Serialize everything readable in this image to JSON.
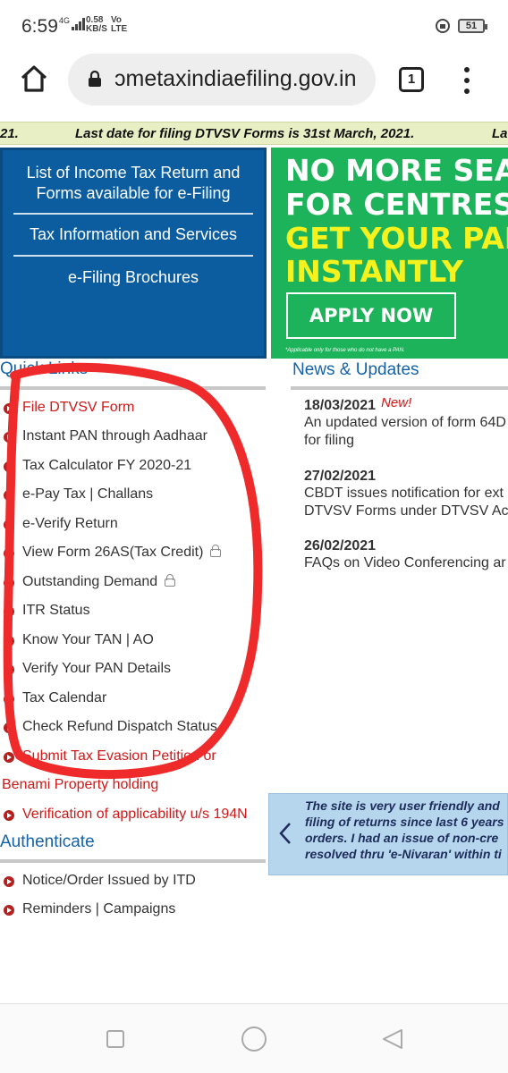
{
  "status_bar": {
    "time": "6:59",
    "network": "4G",
    "speed_value": "0.58",
    "speed_unit": "KB/S",
    "volte_top": "Vo",
    "volte_bottom": "LTE",
    "battery": "51"
  },
  "browser": {
    "url": "ɔmetaxindiaefiling.gov.in",
    "tab_count": "1"
  },
  "ticker": {
    "left_fragment": "21.",
    "message": "Last date for filing DTVSV Forms is 31st March, 2021.",
    "right_fragment": "La"
  },
  "blue_menu": {
    "items": [
      "List of Income Tax Return and Forms available for e-Filing",
      "Tax Information and Services",
      "e-Filing Brochures"
    ]
  },
  "banner": {
    "line1": "NO MORE SEA",
    "line2": "FOR CENTRES.",
    "line3": "GET YOUR PAN",
    "line4": "INSTANTLY",
    "apply": "APPLY NOW",
    "note": "*Applicable only for those who do not have a PAN.",
    "colors": {
      "background": "#1db35a",
      "white": "#ffffff",
      "yellow": "#f5f21e"
    }
  },
  "quick_links": {
    "heading": "Quick Links",
    "items": [
      {
        "label": "File DTVSV Form",
        "style": "red"
      },
      {
        "label": "Instant PAN through Aadhaar",
        "style": "dark"
      },
      {
        "label": "Tax Calculator FY 2020-21",
        "style": "dark"
      },
      {
        "label": "e-Pay Tax | Challans",
        "style": "dark"
      },
      {
        "label": "e-Verify Return",
        "style": "dark"
      },
      {
        "label": "View Form 26AS(Tax Credit)",
        "style": "dark",
        "lock": true
      },
      {
        "label": "Outstanding Demand",
        "style": "dark",
        "lock": true
      },
      {
        "label": "ITR Status",
        "style": "dark"
      },
      {
        "label": "Know Your TAN | AO",
        "style": "dark"
      },
      {
        "label": "Verify Your PAN Details",
        "style": "dark"
      },
      {
        "label": "Tax Calendar",
        "style": "dark"
      },
      {
        "label": "Check Refund Dispatch Status",
        "style": "dark"
      },
      {
        "label": "Submit Tax Evasion Petition or",
        "style": "red"
      },
      {
        "label": "Benami Property holding",
        "style": "red",
        "no_bullet": true
      },
      {
        "label": "Verification of applicability u/s 194N",
        "style": "red"
      }
    ]
  },
  "authenticate": {
    "heading": "Authenticate",
    "items": [
      "Notice/Order Issued by ITD",
      "Reminders | Campaigns"
    ]
  },
  "news": {
    "heading": "News & Updates",
    "new_badge": "New!",
    "items": [
      {
        "date": "18/03/2021",
        "lines": [
          "An updated version of form 64D",
          "for filing"
        ]
      },
      {
        "date": "27/02/2021",
        "lines": [
          "CBDT issues notification for ext",
          "DTVSV Forms under DTVSV Ac"
        ]
      },
      {
        "date": "26/02/2021",
        "lines": [
          "FAQs on Video Conferencing ar"
        ]
      }
    ]
  },
  "testimonial": {
    "lines": [
      "The site is very user friendly and",
      "filing of returns since last 6 years",
      "orders. I had an issue of non-cre",
      "resolved thru 'e-Nivaran' within ti"
    ]
  },
  "colors": {
    "link_red": "#d01818",
    "heading_blue": "#1463a8",
    "panel_blue": "#0b5da0",
    "ticker_bg": "#e9efc4",
    "annotation_red": "#ee2a2a"
  }
}
